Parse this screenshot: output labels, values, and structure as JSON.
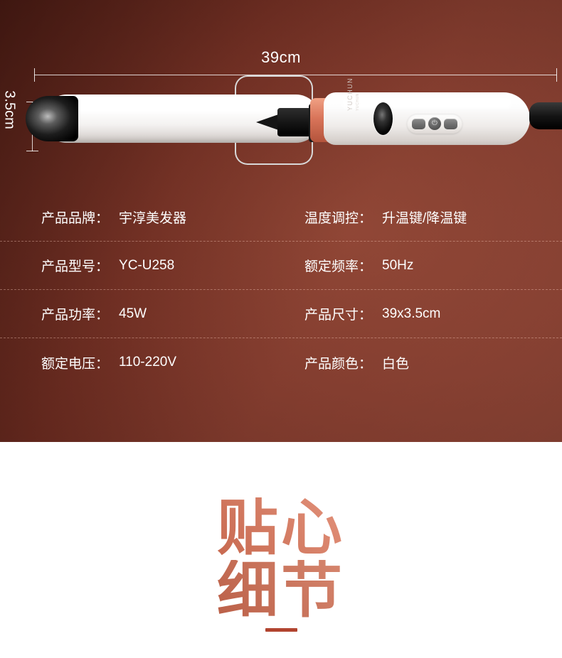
{
  "hero": {
    "dimensions": {
      "length_label": "39cm",
      "width_label": "3.5cm"
    },
    "product": {
      "brand_mark": "YUCHUN",
      "brand_sub": "YUCHUN",
      "power_icon": "⏻"
    }
  },
  "spec": {
    "rows": [
      {
        "left_key": "产品品牌：",
        "left_val": "宇淳美发器",
        "right_key": "温度调控：",
        "right_val": "升温键/降温键"
      },
      {
        "left_key": "产品型号：",
        "left_val": "YC-U258",
        "right_key": "额定频率：",
        "right_val": "50Hz"
      },
      {
        "left_key": "产品功率：",
        "left_val": "45W",
        "right_key": "产品尺寸：",
        "right_val": "39x3.5cm"
      },
      {
        "left_key": "额定电压：",
        "left_val": "110-220V",
        "right_key": "产品颜色：",
        "right_val": "白色"
      }
    ]
  },
  "bottom": {
    "headline_line1": "贴心",
    "headline_line2": "细节"
  },
  "colors": {
    "hero_dark": "#471a14",
    "hero_mid": "#6a2b20",
    "hero_light": "#8b4030",
    "accent_rose_gold": "#d9755a",
    "headline_dark": "#9e3f2b",
    "headline_light": "#f0b09a",
    "underbar": "#b1442f",
    "text_white": "#ffffff"
  }
}
